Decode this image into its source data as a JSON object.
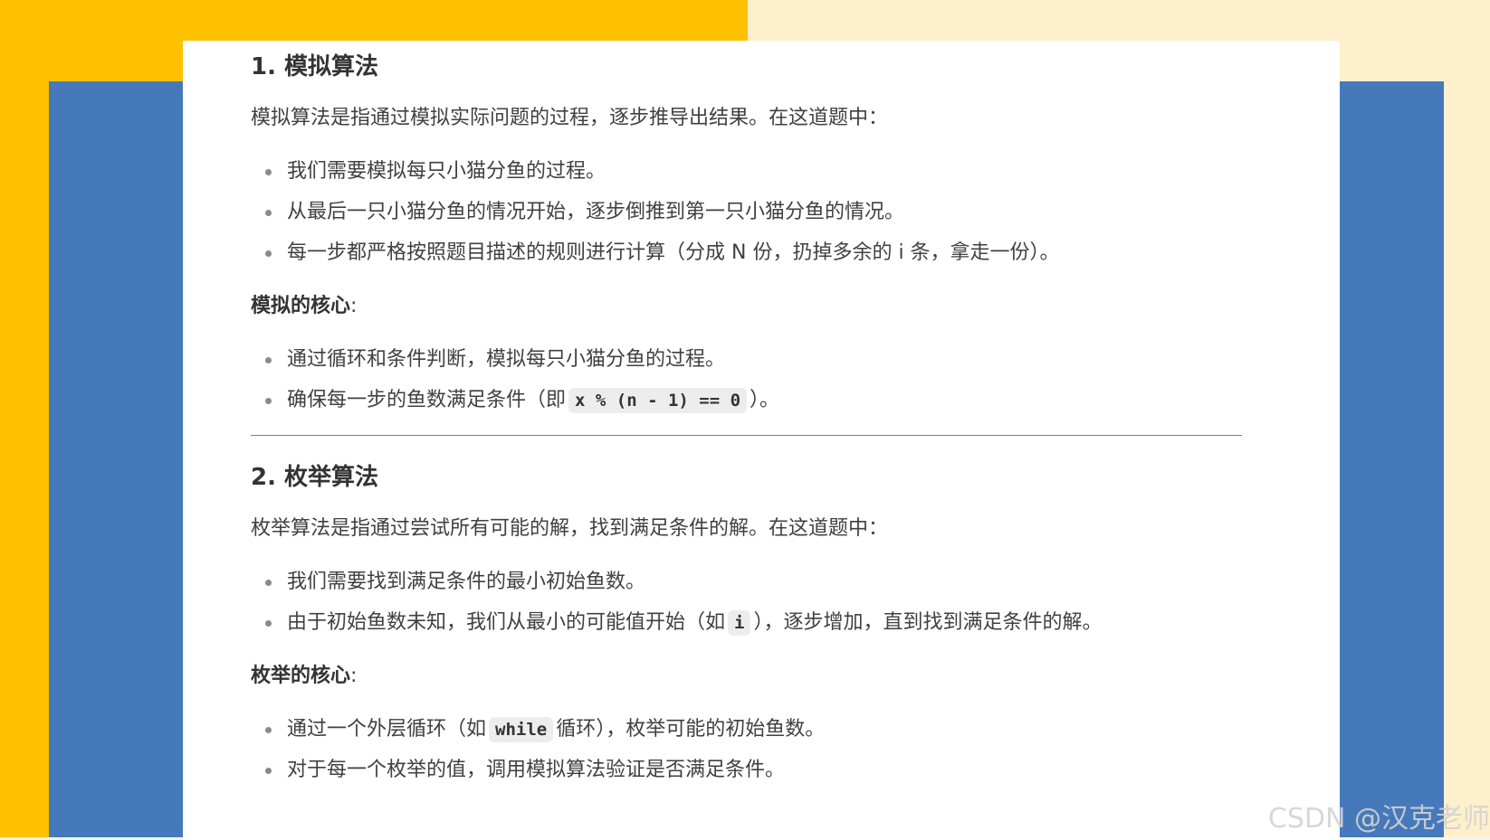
{
  "section1": {
    "heading": "1. 模拟算法",
    "intro": "模拟算法是指通过模拟实际问题的过程，逐步推导出结果。在这道题中：",
    "bullets": [
      "我们需要模拟每只小猫分鱼的过程。",
      "从最后一只小猫分鱼的情况开始，逐步倒推到第一只小猫分鱼的情况。",
      "每一步都严格按照题目描述的规则进行计算（分成 N 份，扔掉多余的 i 条，拿走一份）。"
    ],
    "core_label": "模拟的核心",
    "core_colon": ":",
    "core_bullets": {
      "b1": "通过循环和条件判断，模拟每只小猫分鱼的过程。",
      "b2_before": "确保每一步的鱼数满足条件（即",
      "b2_code": "x % (n - 1) == 0",
      "b2_after": "）。"
    }
  },
  "section2": {
    "heading": "2. 枚举算法",
    "intro": "枚举算法是指通过尝试所有可能的解，找到满足条件的解。在这道题中：",
    "bullets": {
      "b1": "我们需要找到满足条件的最小初始鱼数。",
      "b2_before": "由于初始鱼数未知，我们从最小的可能值开始（如",
      "b2_code": "i",
      "b2_after": "），逐步增加，直到找到满足条件的解。"
    },
    "core_label": "枚举的核心",
    "core_colon": ":",
    "core_bullets": {
      "b1_before": "通过一个外层循环（如",
      "b1_code": "while",
      "b1_after": "循环），枚举可能的初始鱼数。",
      "b2": "对于每一个枚举的值，调用模拟算法验证是否满足条件。"
    }
  },
  "watermark": "CSDN @汉克老师",
  "colors": {
    "yellow": "#FDC100",
    "cream": "#FEF0CC",
    "blue": "#4679BB",
    "text": "#404040"
  }
}
